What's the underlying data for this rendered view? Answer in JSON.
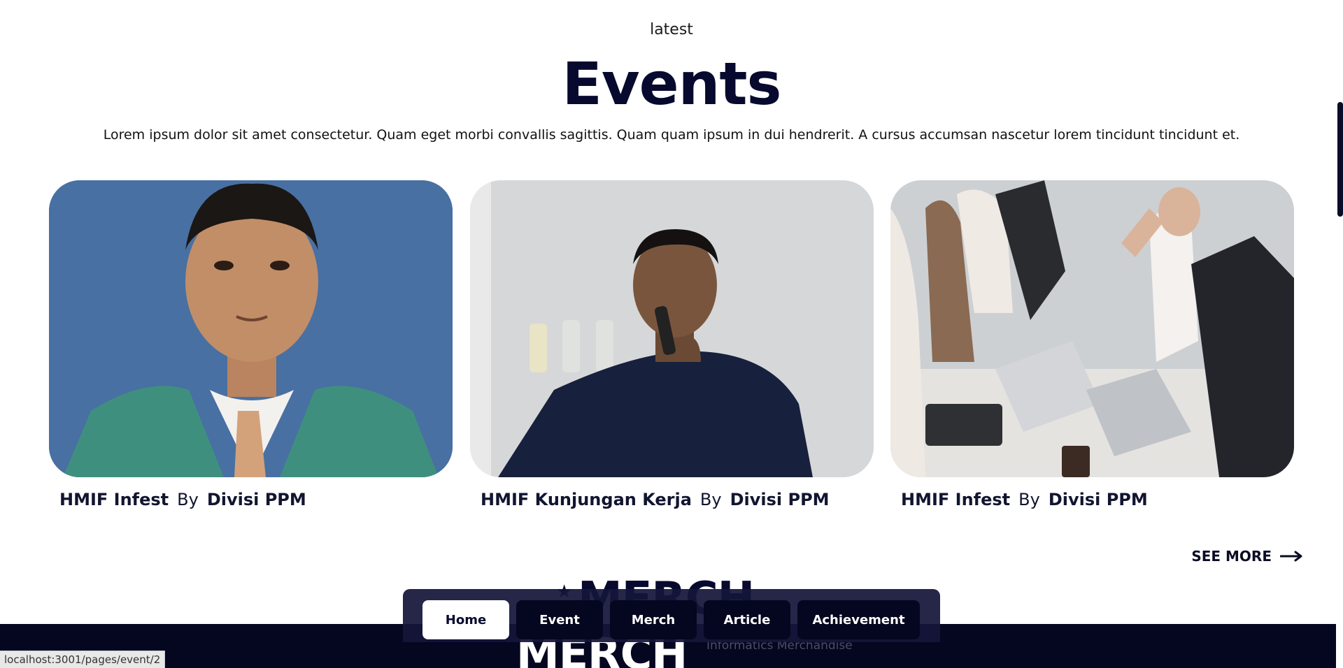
{
  "events_section": {
    "kicker": "latest",
    "title": "Events",
    "description": "Lorem ipsum dolor sit amet consectetur. Quam eget morbi convallis sagittis. Quam quam ipsum in dui hendrerit. A cursus accumsan nascetur lorem tincidunt tincidunt et.",
    "cards": [
      {
        "event": "HMIF Infest",
        "by": "By",
        "author": "Divisi PPM"
      },
      {
        "event": "HMIF Kunjungan Kerja",
        "by": "By",
        "author": "Divisi PPM"
      },
      {
        "event": "HMIF Infest",
        "by": "By",
        "author": "Divisi PPM"
      }
    ],
    "see_more": "SEE MORE"
  },
  "merch_section": {
    "title_top": "MERCH",
    "title_bottom": "MERCH",
    "subtitle": "Informatics Merchandise"
  },
  "navbar": {
    "items": [
      "Home",
      "Event",
      "Merch",
      "Article",
      "Achievement"
    ],
    "active": "Home"
  },
  "status_bar": {
    "url": "localhost:3001/pages/event/2"
  },
  "colors": {
    "navy": "#070a2e",
    "footer": "#05061f",
    "white": "#ffffff"
  }
}
